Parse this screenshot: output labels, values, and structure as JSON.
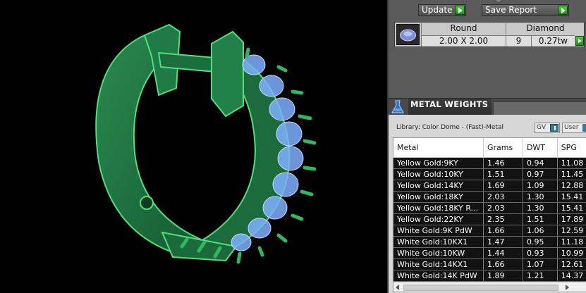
{
  "toolbar": {
    "update_label": "Update",
    "save_report_label": "Save Report"
  },
  "stone": {
    "headers": [
      "Round",
      "Diamond"
    ],
    "size": "2.00 X 2.00",
    "count": "9",
    "weight": "0.27tw"
  },
  "metal_weights": {
    "title": "METAL WEIGHTS",
    "library": "Library: Color Dome - (Fast)-Metal",
    "gv_label": "GV",
    "user_label": "User",
    "columns": [
      "Metal",
      "Grams",
      "DWT",
      "SPG"
    ],
    "rows": [
      [
        "Yellow Gold:9KY",
        "1.46",
        "0.94",
        "11.08"
      ],
      [
        "Yellow Gold:10KY",
        "1.51",
        "0.97",
        "11.45"
      ],
      [
        "Yellow Gold:14KY",
        "1.69",
        "1.09",
        "12.88"
      ],
      [
        "Yellow Gold:18KY",
        "2.03",
        "1.30",
        "15.41"
      ],
      [
        "Yellow Gold:18KY R...",
        "2.03",
        "1.30",
        "15.41"
      ],
      [
        "Yellow Gold:22KY",
        "2.35",
        "1.51",
        "17.89"
      ],
      [
        "White Gold:9K PdW",
        "1.66",
        "1.06",
        "12.59"
      ],
      [
        "White Gold:10KX1",
        "1.47",
        "0.95",
        "11.18"
      ],
      [
        "White Gold:10KW",
        "1.44",
        "0.93",
        "10.99"
      ],
      [
        "White Gold:14KX1",
        "1.66",
        "1.07",
        "12.61"
      ],
      [
        "White Gold:14K PdW",
        "1.89",
        "1.21",
        "14.37"
      ]
    ]
  },
  "colors": {
    "metal_green": "#1f7a45",
    "wire_green": "#3ec66a",
    "stone_blue": "#7fb0ff",
    "go_green": "#2fb21f"
  },
  "icons": {
    "update": "play-arrow-icon",
    "save": "play-arrow-icon",
    "stone": "gem-icon",
    "metal": "flask-icon",
    "gv": "info-icon"
  }
}
